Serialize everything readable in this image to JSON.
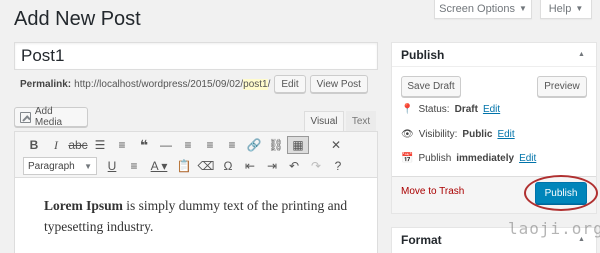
{
  "header": {
    "title": "Add New Post",
    "screen_options": "Screen Options",
    "help": "Help"
  },
  "post": {
    "title_value": "Post1",
    "permalink_label": "Permalink:",
    "permalink_base": "http://localhost/wordpress/2015/09/02/",
    "permalink_slug": "post1",
    "permalink_trailing": "/",
    "edit_button": "Edit",
    "view_button": "View Post"
  },
  "editor": {
    "add_media": "Add Media",
    "tab_visual": "Visual",
    "tab_text": "Text",
    "format_select": "Paragraph",
    "content_bold": "Lorem Ipsum",
    "content_rest": " is simply dummy text of the printing and typesetting industry."
  },
  "publish": {
    "title": "Publish",
    "save_draft": "Save Draft",
    "preview": "Preview",
    "status_label": "Status:",
    "status_value": "Draft",
    "visibility_label": "Visibility:",
    "visibility_value": "Public",
    "schedule_label": "Publish",
    "schedule_value": "immediately",
    "edit_link": "Edit",
    "move_to_trash": "Move to Trash",
    "publish_button": "Publish"
  },
  "format_box": {
    "title": "Format"
  },
  "watermark": "laoji.org",
  "colors": {
    "primary": "#0085ba",
    "link": "#0073aa",
    "trash": "#a00",
    "highlight": "#b03030"
  }
}
